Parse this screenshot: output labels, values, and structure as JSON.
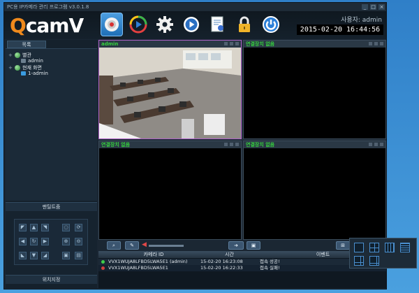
{
  "window": {
    "title": "PC용 IP카메라 관리 프로그램 v3.0.1.8"
  },
  "header": {
    "logo_q": "Q",
    "logo_rest": "camV",
    "user_label": "사용자: admin",
    "clock": "2015-02-20  16:44:56",
    "toolbar_icons": [
      "camera-view-icon",
      "playback-icon",
      "settings-gear-icon",
      "media-play-icon",
      "document-icon",
      "lock-icon",
      "power-icon"
    ]
  },
  "sidebar": {
    "tab_label": "목록",
    "tree": [
      {
        "label": "별관",
        "type": "group"
      },
      {
        "label": "admin",
        "type": "camera"
      },
      {
        "label": "현재 화면",
        "type": "group"
      },
      {
        "label": "1-admin",
        "type": "camera"
      }
    ],
    "ptz_title": "팬틸트줌",
    "preset_title": "위치지정"
  },
  "grid": {
    "panes": [
      {
        "label": "admin",
        "label_color": "#36d13e"
      },
      {
        "label": "연결장치 없음",
        "label_color": "#36d13e"
      },
      {
        "label": "연결장치 없음",
        "label_color": "#36d13e"
      },
      {
        "label": "연결장치 없음",
        "label_color": "#36d13e"
      }
    ]
  },
  "events": {
    "headers": [
      "카메라 ID",
      "시간",
      "이벤트"
    ],
    "rows": [
      {
        "status_color": "#3fcf4a",
        "camera_id": "VVX1WUJA8LFBD5LWA5E1 (admin)",
        "time": "15-02-20 16:23:08",
        "event": "접속 성공!"
      },
      {
        "status_color": "#d04040",
        "camera_id": "VVX1WUJA8LFBD5LWA5E1",
        "time": "15-02-20 16:22:33",
        "event": "접속 실패!"
      }
    ]
  },
  "layout_options": [
    "layout-1x1-icon",
    "layout-2x2-icon",
    "layout-3x3-icon",
    "layout-4x4-icon",
    "layout-1plus5-icon",
    "layout-1plus7-icon"
  ]
}
